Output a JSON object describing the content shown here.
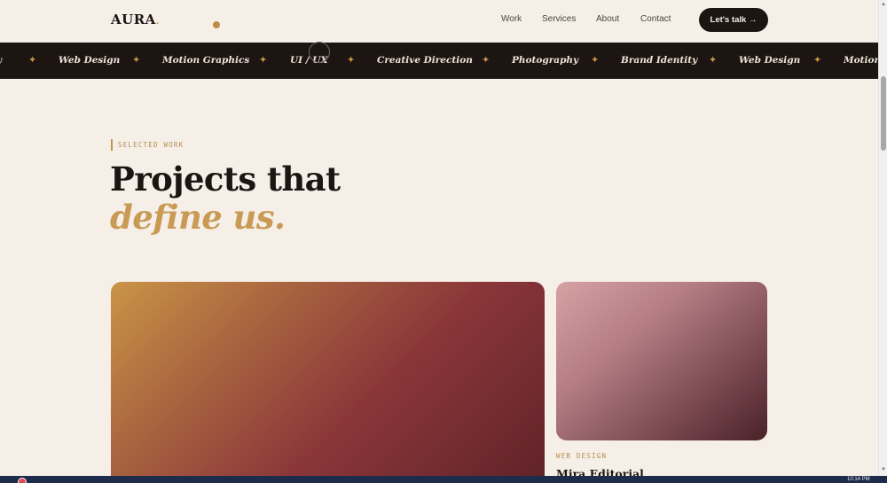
{
  "brand": {
    "logo_text": "AURA",
    "logo_dot": "."
  },
  "nav": {
    "items": [
      "Work",
      "Services",
      "About",
      "Contact"
    ],
    "cta_label": "Let's talk →"
  },
  "marquee": {
    "separator": "✦",
    "items": [
      "y",
      "Web Design",
      "Motion Graphics",
      "UI / UX",
      "Creative Direction",
      "Photography",
      "Brand Identity",
      "Web Design",
      "Motion G"
    ]
  },
  "section": {
    "eyebrow": "SELECTED WORK",
    "headline_line1": "Projects that",
    "headline_line2": "define us."
  },
  "cards": [
    {
      "name": "featured-project"
    },
    {
      "tag": "WEB DESIGN",
      "title": "Mira Editorial"
    }
  ],
  "colors": {
    "background": "#f5efe8",
    "ink": "#1c1512",
    "accent_gold": "#c99a56",
    "marquee_bg": "#1c1512"
  },
  "icons": {
    "marquee_separator": "sparkle-icon",
    "scroll_up": "chevron-up-icon",
    "scroll_down": "chevron-down-icon"
  },
  "taskbar": {
    "time": "10:14 PM"
  }
}
